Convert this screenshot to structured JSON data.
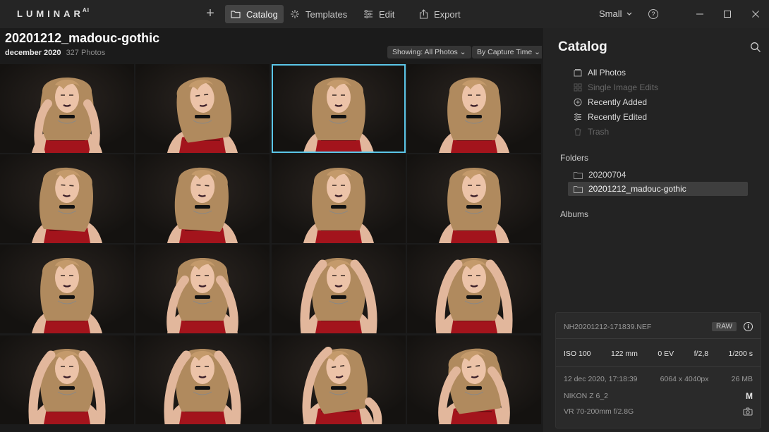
{
  "app": {
    "logo_text": "LUMINAR",
    "logo_suffix": "AI"
  },
  "toolbar": {
    "add_label": "+",
    "tabs": [
      {
        "label": "Catalog",
        "icon": "folder-icon",
        "active": true
      },
      {
        "label": "Templates",
        "icon": "sparkle-icon",
        "active": false
      },
      {
        "label": "Edit",
        "icon": "sliders-icon",
        "active": false
      },
      {
        "label": "Export",
        "icon": "share-icon",
        "active": false
      }
    ],
    "size_value": "Small",
    "help_label": "?"
  },
  "grid": {
    "folder_title": "20201212_madouc-gothic",
    "date_label": "december 2020",
    "count_label": "327 Photos",
    "filter_label": "Showing: All Photos",
    "sort_label": "By Capture Time",
    "selected_index": 2,
    "photos": [
      {
        "pose": "hand-right-hair"
      },
      {
        "pose": "smile-tilt"
      },
      {
        "pose": "look-down"
      },
      {
        "pose": "straight"
      },
      {
        "pose": "smile-left"
      },
      {
        "pose": "smile-left"
      },
      {
        "pose": "straight-smile"
      },
      {
        "pose": "straight"
      },
      {
        "pose": "straight"
      },
      {
        "pose": "hands-hair-both-low"
      },
      {
        "pose": "hands-head"
      },
      {
        "pose": "hands-head"
      },
      {
        "pose": "hands-head-closed"
      },
      {
        "pose": "hands-head-closed"
      },
      {
        "pose": "arm-up-tilt"
      },
      {
        "pose": "hands-hair-tilt"
      }
    ]
  },
  "sidebar": {
    "title": "Catalog",
    "library_items": [
      {
        "label": "All Photos",
        "icon": "photos-icon",
        "enabled": true
      },
      {
        "label": "Single Image Edits",
        "icon": "grid-icon",
        "enabled": false
      },
      {
        "label": "Recently Added",
        "icon": "plus-circle-icon",
        "enabled": true
      },
      {
        "label": "Recently Edited",
        "icon": "sliders-icon",
        "enabled": true
      },
      {
        "label": "Trash",
        "icon": "trash-icon",
        "enabled": false
      }
    ],
    "folders_label": "Folders",
    "folders": [
      {
        "label": "20200704",
        "active": false
      },
      {
        "label": "20201212_madouc-gothic",
        "active": true
      }
    ],
    "albums_label": "Albums"
  },
  "info": {
    "filename": "NH20201212-171839.NEF",
    "format_badge": "RAW",
    "iso": "ISO 100",
    "focal": "122 mm",
    "ev": "0 EV",
    "aperture": "f/2,8",
    "shutter": "1/200 s",
    "datetime": "12 dec 2020, 17:18:39",
    "dimensions": "6064 x 4040px",
    "filesize": "26 MB",
    "camera": "NIKON Z 6_2",
    "mode": "M",
    "lens": "VR 70-200mm f/2.8G"
  },
  "colors": {
    "accent_selection": "#5bc6e8",
    "active_tab_bg": "#444444",
    "panel_bg": "#232323"
  }
}
